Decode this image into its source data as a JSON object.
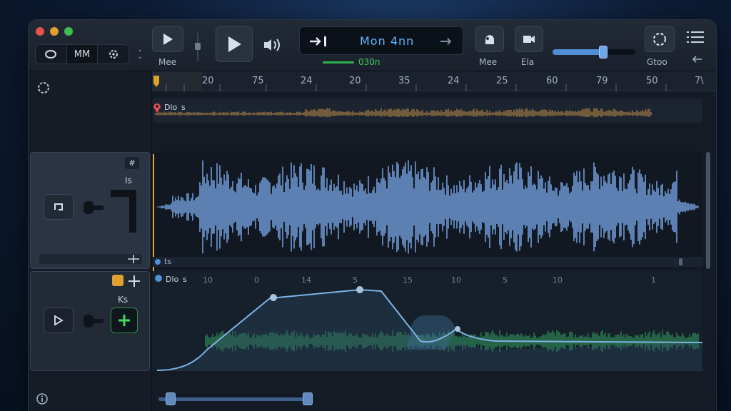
{
  "window": {
    "traffic_lights": [
      "#e5534b",
      "#e0a030",
      "#3fbe4f"
    ]
  },
  "toolbar": {
    "view_seg": [
      "",
      "MM",
      ""
    ],
    "play_small_label": "Mee",
    "lcd_text": "Mon  4nn",
    "counter": "030n",
    "metronome_label": "Mee",
    "export_label": "Ela",
    "volume_level": 0.56,
    "settings_label": "Gtoo"
  },
  "ruler": {
    "ticks": [
      "20",
      "75",
      "24",
      "20",
      "35",
      "24",
      "25",
      "60",
      "79",
      "50",
      "7\\"
    ]
  },
  "tracks": {
    "top_clip_name": "Dlo",
    "top_clip_suffix": "s",
    "audio_header_badge": "#",
    "audio_header_label": "Is",
    "audio_region_tag": "ts",
    "auto_clip_name": "Dlo",
    "auto_clip_suffix": "s",
    "auto_header_label": "Ks",
    "auto_ticks": [
      "10",
      "0",
      "14",
      "5",
      "15",
      "10",
      "5",
      "10",
      "1"
    ]
  },
  "colors": {
    "accent": "#4f8fd6",
    "wave_blue": "#6f9ad6",
    "wave_green": "#2f8a58",
    "playhead": "#e0a030"
  }
}
